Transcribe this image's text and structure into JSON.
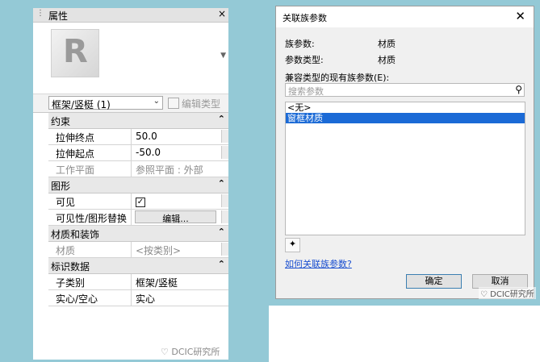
{
  "properties": {
    "title": "属性",
    "close": "×",
    "logo_letter": "R",
    "type_selector": {
      "value": "框架/竖梃 (1)",
      "caret": "⌄"
    },
    "edit_type_label": "编辑类型",
    "groups": [
      {
        "label": "约束",
        "collapse": "⌃"
      },
      {
        "label": "图形",
        "collapse": "⌃"
      },
      {
        "label": "材质和装饰",
        "collapse": "⌃"
      },
      {
        "label": "标识数据",
        "collapse": "⌃"
      }
    ],
    "rows": {
      "extrusion_end": {
        "key": "拉伸终点",
        "value": "50.0"
      },
      "extrusion_start": {
        "key": "拉伸起点",
        "value": "-50.0"
      },
      "work_plane": {
        "key": "工作平面",
        "value": "参照平面 : 外部"
      },
      "visible": {
        "key": "可见",
        "value": "✓"
      },
      "visibility_override": {
        "key": "可见性/图形替换",
        "button": "编辑..."
      },
      "material": {
        "key": "材质",
        "value": "<按类别>"
      },
      "subcategory": {
        "key": "子类别",
        "value": "框架/竖梃"
      },
      "solid_void": {
        "key": "实心/空心",
        "value": "实心"
      }
    },
    "watermark": "DCIC研究所"
  },
  "dialog": {
    "title": "关联族参数",
    "close": "✕",
    "family_param_label": "族参数:",
    "family_param_value": "材质",
    "param_type_label": "参数类型:",
    "param_type_value": "材质",
    "compatible_label": "兼容类型的现有族参数(E):",
    "search_placeholder": "搜索参数",
    "items": [
      "<无>",
      "窗框材质"
    ],
    "selected_index": 1,
    "help_link": "如何关联族参数?",
    "ok": "确定",
    "cancel": "取消",
    "watermark": "DCIC研究所"
  },
  "colors": {
    "selection": "#1b6ad6",
    "link": "#1a4fd0",
    "background": "#94c9d6"
  }
}
